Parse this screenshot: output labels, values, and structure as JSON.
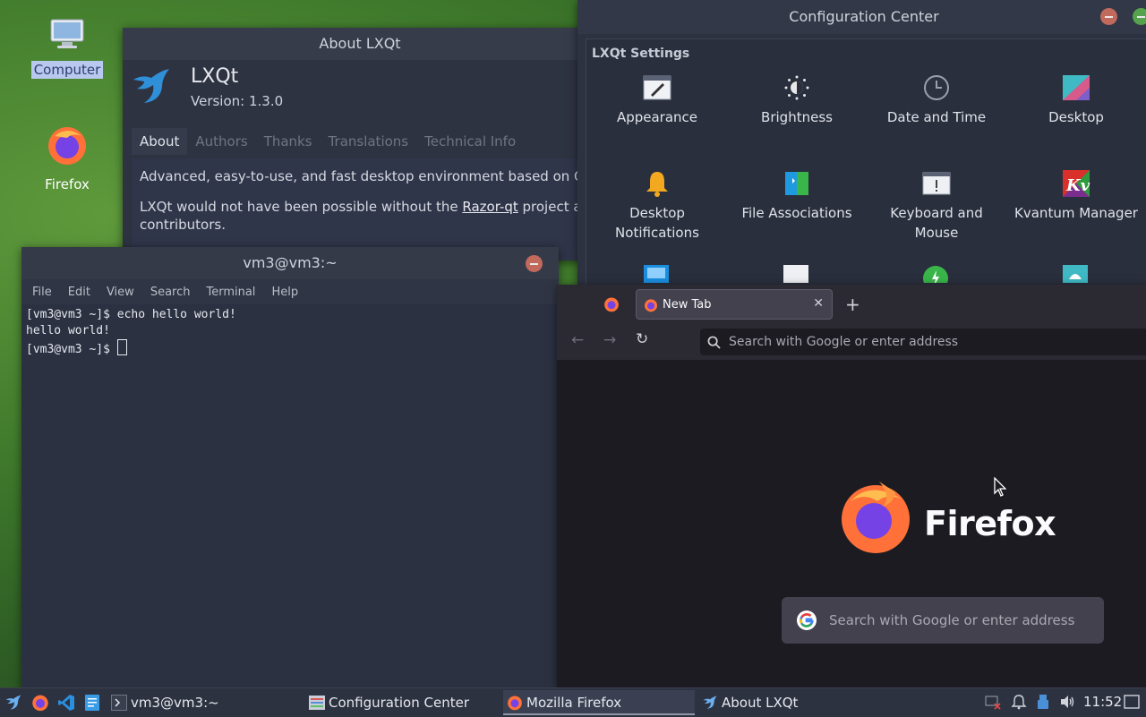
{
  "desktop": {
    "icons": [
      {
        "label": "Computer"
      },
      {
        "label": "Firefox"
      }
    ]
  },
  "about": {
    "window_title": "About LXQt",
    "app_name": "LXQt",
    "version": "Version: 1.3.0",
    "tabs": [
      "About",
      "Authors",
      "Thanks",
      "Translations",
      "Technical Info"
    ],
    "description": "Advanced, easy-to-use, and fast desktop environment based on Qt tec",
    "razor_prefix": "LXQt would not have been possible without the ",
    "razor_link": "Razor-qt",
    "razor_suffix": " project and it",
    "contributors": "contributors."
  },
  "config": {
    "window_title": "Configuration Center",
    "section": "LXQt Settings",
    "items": [
      {
        "label": "Appearance",
        "icon": "appearance-icon"
      },
      {
        "label": "Brightness",
        "icon": "brightness-icon"
      },
      {
        "label": "Date and Time",
        "icon": "clock-icon"
      },
      {
        "label": "Desktop",
        "icon": "desktop-icon"
      },
      {
        "label": "Desktop Notifications",
        "icon": "bell-icon"
      },
      {
        "label": "File Associations",
        "icon": "file-associations-icon"
      },
      {
        "label": "Keyboard and Mouse",
        "icon": "keyboard-icon"
      },
      {
        "label": "Kvantum Manager",
        "icon": "kvantum-icon"
      }
    ]
  },
  "terminal": {
    "window_title": "vm3@vm3:~",
    "menu": [
      "File",
      "Edit",
      "View",
      "Search",
      "Terminal",
      "Help"
    ],
    "lines": [
      "[vm3@vm3 ~]$ echo hello world!",
      "hello world!",
      "[vm3@vm3 ~]$ "
    ]
  },
  "firefox": {
    "tab_title": "New Tab",
    "url_placeholder": "Search with Google or enter address",
    "wordmark": "Firefox",
    "search_placeholder": "Search with Google or enter address"
  },
  "taskbar": {
    "tasks": [
      {
        "label": "vm3@vm3:~"
      },
      {
        "label": "Configuration Center"
      },
      {
        "label": "Mozilla Firefox"
      },
      {
        "label": "About LXQt"
      }
    ],
    "clock": "11:52"
  }
}
